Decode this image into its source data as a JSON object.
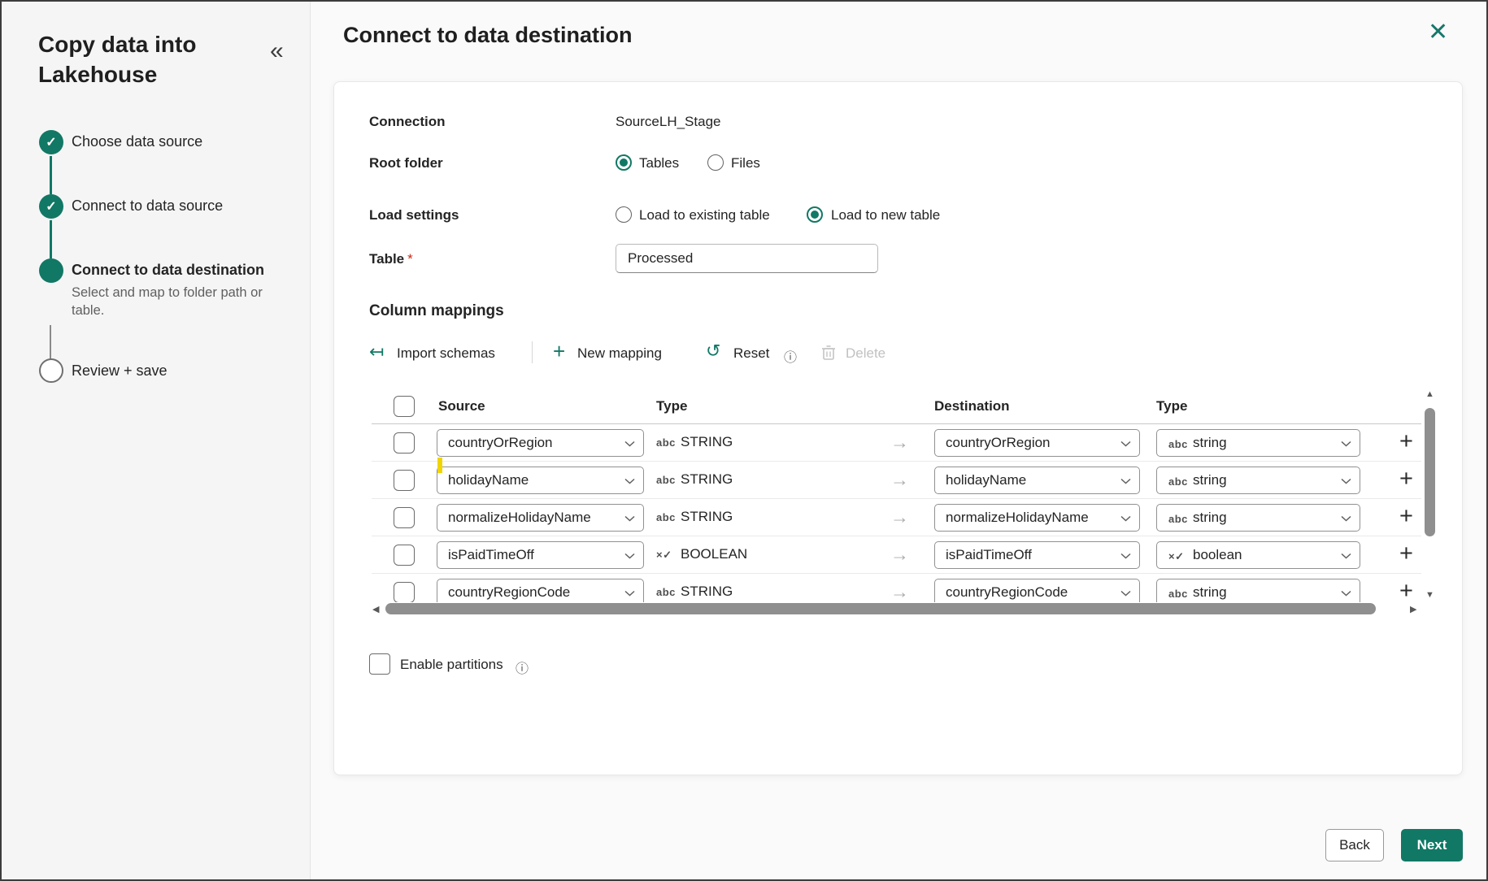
{
  "window": {
    "close_icon": "✕"
  },
  "sidebar": {
    "title": "Copy data into Lakehouse",
    "collapse_icon": "«",
    "steps": [
      {
        "label": "Choose data source",
        "state": "done",
        "check": "✓"
      },
      {
        "label": "Connect to data source",
        "state": "done",
        "check": "✓"
      },
      {
        "label": "Connect to data destination",
        "state": "current",
        "description": "Select and map to folder path or table."
      },
      {
        "label": "Review + save",
        "state": "todo"
      }
    ]
  },
  "header": {
    "title": "Connect to data destination"
  },
  "form": {
    "connection_label": "Connection",
    "connection_value": "SourceLH_Stage",
    "root_folder_label": "Root folder",
    "root_options": [
      {
        "label": "Tables",
        "selected": true
      },
      {
        "label": "Files",
        "selected": false
      }
    ],
    "load_settings_label": "Load settings",
    "load_options": [
      {
        "label": "Load to existing table",
        "selected": false
      },
      {
        "label": "Load to new table",
        "selected": true
      }
    ],
    "table_label": "Table",
    "required_mark": "*",
    "table_value": "Processed"
  },
  "mappings": {
    "title": "Column mappings",
    "toolbar": {
      "import_icon": "↤",
      "import_label": "Import schemas",
      "new_icon": "+",
      "new_label": "New mapping",
      "reset_icon": "↺",
      "reset_label": "Reset",
      "info_icon": "ⓘ",
      "delete_label": "Delete"
    },
    "headers": {
      "source": "Source",
      "type": "Type",
      "destination": "Destination",
      "dest_type": "Type"
    },
    "rows": [
      {
        "source": "countryOrRegion",
        "type_icon": "abc",
        "type": "STRING",
        "arrow": "→",
        "dest": "countryOrRegion",
        "dest_type_icon": "abc",
        "dest_type": "string"
      },
      {
        "source": "holidayName",
        "type_icon": "abc",
        "type": "STRING",
        "arrow": "→",
        "dest": "holidayName",
        "dest_type_icon": "abc",
        "dest_type": "string"
      },
      {
        "source": "normalizeHolidayName",
        "type_icon": "abc",
        "type": "STRING",
        "arrow": "→",
        "dest": "normalizeHolidayName",
        "dest_type_icon": "abc",
        "dest_type": "string"
      },
      {
        "source": "isPaidTimeOff",
        "type_icon": "×✓",
        "type": "BOOLEAN",
        "arrow": "→",
        "dest": "isPaidTimeOff",
        "dest_type_icon": "×✓",
        "dest_type": "boolean"
      },
      {
        "source": "countryRegionCode",
        "type_icon": "abc",
        "type": "STRING",
        "arrow": "→",
        "dest": "countryRegionCode",
        "dest_type_icon": "abc",
        "dest_type": "string"
      }
    ],
    "row_add_icon": "+",
    "scrollbar": {
      "up": "▲",
      "down": "▼",
      "left": "◀",
      "right": "▶"
    }
  },
  "partitions": {
    "label": "Enable partitions",
    "info_icon": "ⓘ"
  },
  "footer": {
    "back_label": "Back",
    "next_label": "Next"
  },
  "colors": {
    "brand": "#117865"
  }
}
